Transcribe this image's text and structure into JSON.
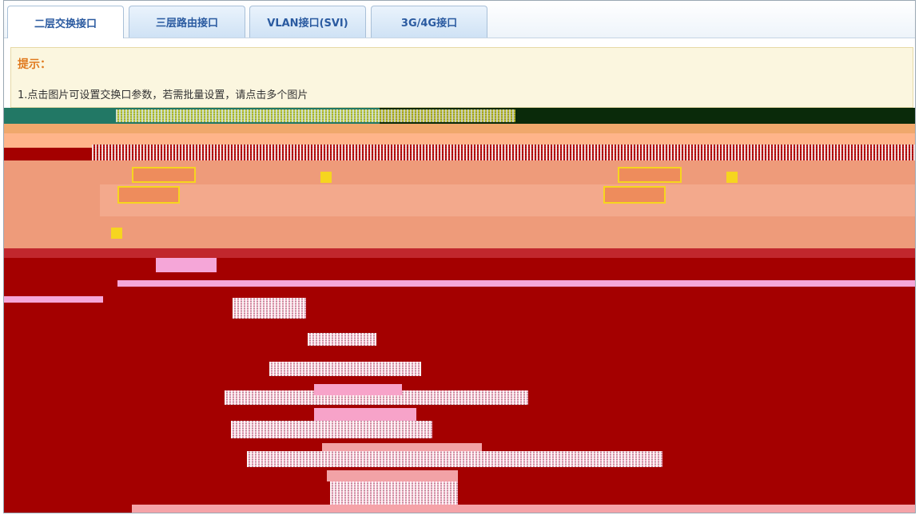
{
  "tabs": [
    {
      "label": "二层交换接口",
      "active": true
    },
    {
      "label": "三层路由接口",
      "active": false
    },
    {
      "label": "VLAN接口(SVI)",
      "active": false
    },
    {
      "label": "3G/4G接口",
      "active": false
    }
  ],
  "tip": {
    "title": "提示：",
    "line1": "1.点击图片可设置交换口参数，若需批量设置，请点击多个图片"
  },
  "colors": {
    "accent": "#2a5aa0",
    "tip_title": "#e07a1f",
    "tip_bg": "#fbf6df",
    "corrupt_red": "#a40000"
  }
}
